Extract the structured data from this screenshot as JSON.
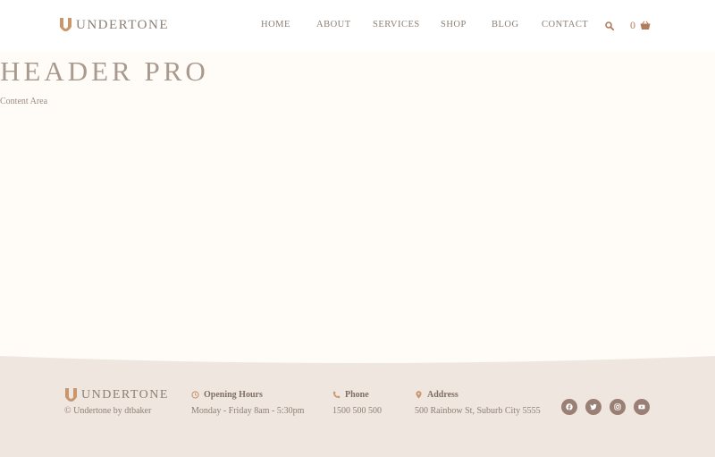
{
  "brand": {
    "name": "UNDERTONE",
    "accent": "#c8976b"
  },
  "nav": {
    "items": [
      {
        "label": "HOME"
      },
      {
        "label": "ABOUT"
      },
      {
        "label": "SERVICES"
      },
      {
        "label": "SHOP"
      },
      {
        "label": "BLOG"
      },
      {
        "label": "CONTACT"
      }
    ],
    "cart_count": "0"
  },
  "main": {
    "title": "HEADER PRO",
    "content": "Content Area"
  },
  "footer": {
    "brand_name": "UNDERTONE",
    "copyright": "© Undertone by dtbaker",
    "hours": {
      "title": "Opening Hours",
      "value": "Monday - Friday 8am - 5:30pm"
    },
    "phone": {
      "title": "Phone",
      "value": "1500 500 500"
    },
    "address": {
      "title": "Address",
      "value": "500 Rainbow St, Suburb City 5555"
    },
    "social": [
      "facebook-icon",
      "twitter-icon",
      "instagram-icon",
      "youtube-icon"
    ]
  }
}
